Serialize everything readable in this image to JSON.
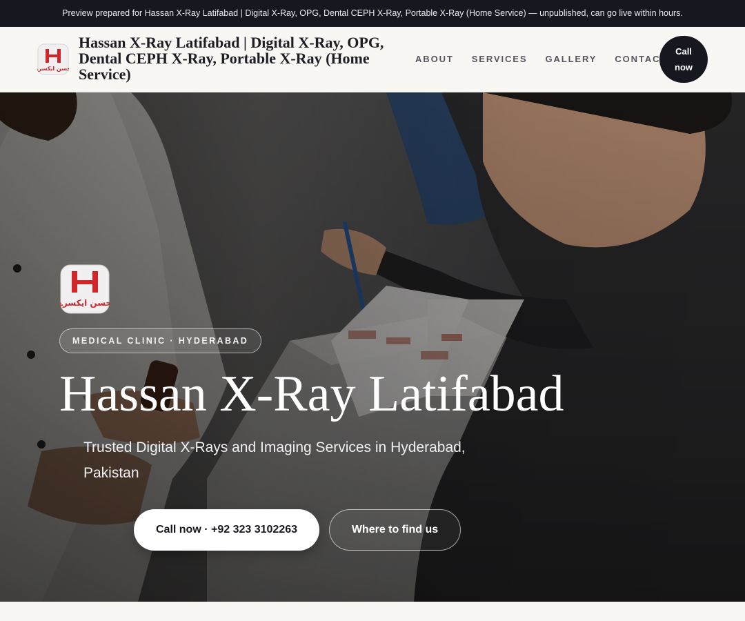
{
  "banner": {
    "text": "Preview prepared for Hassan X-Ray Latifabad | Digital X-Ray, OPG, Dental CEPH X-Ray, Portable X-Ray (Home Service) — unpublished, can go live within hours."
  },
  "header": {
    "logo_icon": "hassan-xray-logo-icon",
    "logo_text": "حسن ایکسرے",
    "title": "Hassan X-Ray Latifabad | Digital X-Ray, OPG, Dental CEPH X-Ray, Portable X-Ray (Home Service)",
    "nav": [
      "About",
      "Services",
      "Gallery",
      "Contact"
    ],
    "call_label": "Call now"
  },
  "hero": {
    "logo_icon": "hassan-xray-logo-icon",
    "tag": "MEDICAL CLINIC · HYDERABAD",
    "title": "Hassan X-Ray Latifabad",
    "subtitle": "Trusted Digital X-Rays and Imaging Services in Hyderabad, Pakistan",
    "primary_button": "Call now · +92 323 3102263",
    "secondary_button": "Where to find us"
  },
  "colors": {
    "banner_bg": "#17171f",
    "page_bg": "#f8f7f4",
    "accent_dark": "#17171f",
    "logo_red": "#d0262a"
  }
}
